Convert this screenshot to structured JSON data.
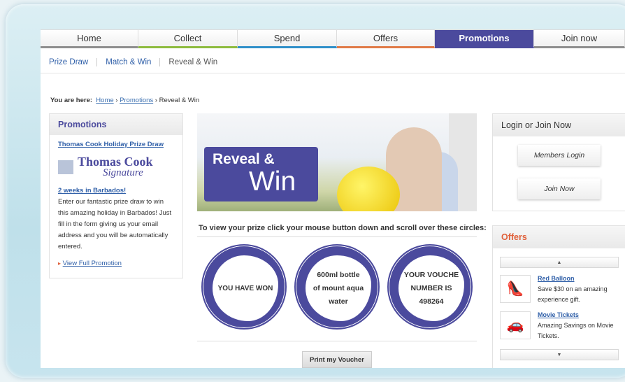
{
  "nav": {
    "tabs": [
      {
        "label": "Home",
        "color": "#8e8e8e"
      },
      {
        "label": "Collect",
        "color": "#8dbb3e"
      },
      {
        "label": "Spend",
        "color": "#2f8fc9"
      },
      {
        "label": "Offers",
        "color": "#e07a47"
      },
      {
        "label": "Promotions",
        "color": "#4b4a9d"
      },
      {
        "label": "Join now",
        "color": "#8e8e8e"
      }
    ],
    "active": "Promotions"
  },
  "subnav": {
    "items": [
      "Prize Draw",
      "Match & Win",
      "Reveal & Win"
    ]
  },
  "breadcrumb": {
    "label": "You are here:",
    "items": [
      "Home",
      "Promotions",
      "Reveal & Win"
    ]
  },
  "promo": {
    "heading": "Promotions",
    "title": "Thomas Cook Holiday Prize Draw",
    "logo_main": "Thomas Cook",
    "logo_sub": "Signature",
    "offer_title": "2 weeks in Barbados!",
    "body": "Enter our fantastic prize draw to win this amazing holiday in Barbados! Just fill in the form giving us your email address and you will be automatically entered.",
    "link": "View Full Promotion"
  },
  "hero": {
    "line1": "Reveal &",
    "line2": "Win"
  },
  "instructions": "To view your prize click your mouse button down and scroll over these circles:",
  "circles": [
    {
      "lines": [
        "YOU HAVE WON"
      ]
    },
    {
      "lines": [
        "600ml bottle",
        "of mount aqua",
        "water"
      ]
    },
    {
      "lines": [
        "YOUR VOUCHE",
        "NUMBER IS",
        "498264"
      ]
    }
  ],
  "print_label": "Print my Voucher",
  "login": {
    "heading": "Login or Join Now",
    "members_login": "Members Login",
    "join_now": "Join Now"
  },
  "offers": {
    "heading": "Offers",
    "items": [
      {
        "title": "Red Balloon",
        "desc": "Save $30 on an amazing experience gift.",
        "icon": "shoe-icon"
      },
      {
        "title": "Movie Tickets",
        "desc": "Amazing Savings on Movie Tickets.",
        "icon": "car-icon"
      }
    ]
  },
  "colors": {
    "brand": "#4b4a9d",
    "offers_heading": "#e0603a",
    "link": "#2f5fa8"
  }
}
